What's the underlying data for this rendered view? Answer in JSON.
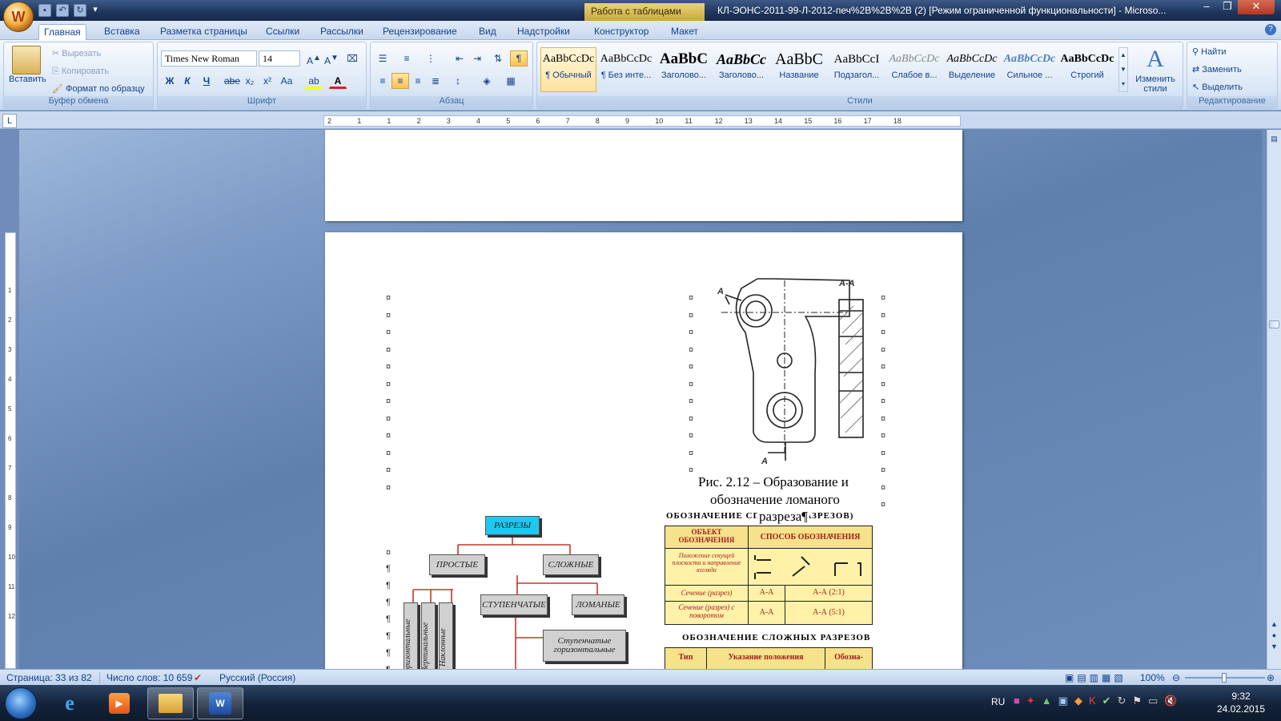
{
  "app": {
    "office_button_glyph": "W",
    "qat_icons": [
      "save-icon",
      "undo-icon",
      "redo-icon",
      "customize-icon"
    ],
    "context_tab": "Работа с таблицами",
    "window_title": "КЛ-ЭОНС-2011-99-Л-2012-печ%2B%2B%2B (2) [Режим ограниченной функциональности] - Microso...",
    "window_buttons": [
      "–",
      "❐",
      "✕"
    ]
  },
  "tabs": [
    "Главная",
    "Вставка",
    "Разметка страницы",
    "Ссылки",
    "Рассылки",
    "Рецензирование",
    "Вид",
    "Надстройки",
    "Конструктор",
    "Макет"
  ],
  "ribbon": {
    "clipboard": {
      "label": "Буфер обмена",
      "paste": "Вставить",
      "cut": "Вырезать",
      "copy": "Копировать",
      "format_painter": "Формат по образцу"
    },
    "font": {
      "label": "Шрифт",
      "font_name": "Times New Roman",
      "font_size": "14",
      "bold": "Ж",
      "italic": "К",
      "underline": "Ч",
      "strike": "abe",
      "sub": "x₂",
      "sup": "x²",
      "case": "Aa"
    },
    "paragraph": {
      "label": "Абзац"
    },
    "styles": {
      "label": "Стили",
      "items": [
        {
          "preview": "AaBbCcDc",
          "name": "¶ Обычный"
        },
        {
          "preview": "AaBbCcDc",
          "name": "¶ Без инте..."
        },
        {
          "preview": "AaBbC",
          "name": "Заголово..."
        },
        {
          "preview": "AaBbCc",
          "name": "Заголово..."
        },
        {
          "preview": "AaBbC",
          "name": "Название"
        },
        {
          "preview": "AaBbCcI",
          "name": "Подзагол..."
        },
        {
          "preview": "AaBbCcDc",
          "name": "Слабое в..."
        },
        {
          "preview": "AaBbCcDc",
          "name": "Выделение"
        },
        {
          "preview": "AaBbCcDc",
          "name": "Сильное ..."
        },
        {
          "preview": "AaBbCcDc",
          "name": "Строгий"
        }
      ],
      "change_styles": "Изменить стили"
    },
    "editing": {
      "label": "Редактирование",
      "find": "Найти",
      "replace": "Заменить",
      "select": "Выделить"
    }
  },
  "ruler": {
    "ticks": [
      "2",
      "1",
      "1",
      "2",
      "3",
      "4",
      "5",
      "6",
      "7",
      "8",
      "9",
      "10",
      "11",
      "12",
      "13",
      "14",
      "15",
      "16",
      "17",
      "18"
    ]
  },
  "document": {
    "cell_marker": "¤",
    "para_marker": "¶",
    "fig_caption_line1": "Рис. 2.12 – Образование и",
    "fig_caption_line2": "обозначение ломаного",
    "fig_caption_line3": "разреза¶",
    "drawing_labels": {
      "aa": "А-А",
      "a_top": "А",
      "a_bottom": "А"
    },
    "diagram": {
      "root": "РАЗРЕЗЫ",
      "simple": "ПРОСТЫЕ",
      "complex": "СЛОЖНЫЕ",
      "stepped": "СТУПЕНЧАТЫЕ",
      "broken": "ЛОМАНЫЕ",
      "stepped_horizontal": "Ступенчатые горизонтальные",
      "vertical_labels": [
        "Горизонтальные",
        "Вертикальные",
        "Наклонные"
      ]
    },
    "table1": {
      "title": "ОБОЗНАЧЕНИЕ СПОСОБА РАЗРЕЗОВ)",
      "headers": [
        "ОБЪЕКТ ОБОЗНАЧЕНИЯ",
        "СПОСОБ ОБОЗНАЧЕНИЯ"
      ],
      "rows": [
        [
          "Положение секущей плоскости и направление взгляда",
          ""
        ],
        [
          "Сечение (разрез)",
          "А-А",
          "А-А (2:1)"
        ],
        [
          "Сечение (разрез) с поворотом",
          "А-А",
          "А-А (5:1)"
        ]
      ]
    },
    "table2": {
      "title": "ОБОЗНАЧЕНИЕ СЛОЖНЫХ РАЗРЕЗОВ",
      "headers": [
        "Тип",
        "Указание положения",
        "Обозна-"
      ]
    }
  },
  "status": {
    "page": "Страница: 33 из 82",
    "words": "Число слов: 10 659",
    "language": "Русский (Россия)",
    "zoom": "100%"
  },
  "taskbar": {
    "lang": "RU",
    "time": "9:32",
    "date": "24.02.2015"
  },
  "colors": {
    "accent": "#15428b",
    "diagram_cyan": "#1ec8f0",
    "table_header": "#f6e28a",
    "table_cell": "#fff2a8",
    "line_red": "#c0392b"
  }
}
